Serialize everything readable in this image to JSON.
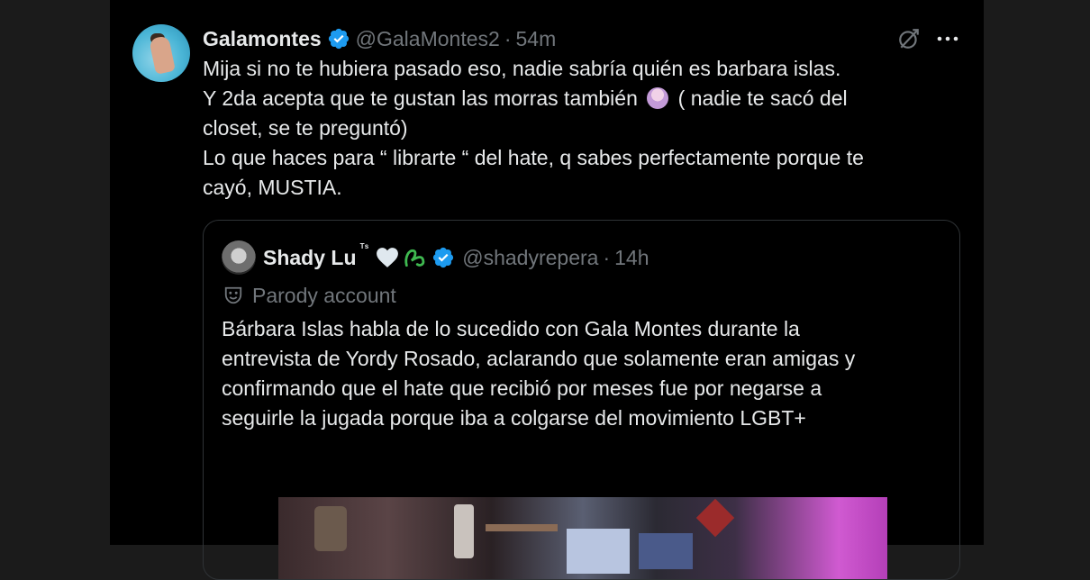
{
  "tweet": {
    "display_name": "Galamontes",
    "handle": "@GalaMontes2",
    "separator": "·",
    "time": "54m",
    "lines": [
      "Mija si no te hubiera pasado eso, nadie sabría quién es barbara islas.",
      "Y 2da  acepta  que te gustan las morras también",
      "( nadie te sacó del",
      "closet, se te preguntó)",
      "Lo que haces para “ librarte  “ del hate, q sabes perfectamente  porque te",
      "cayó, MUSTIA."
    ],
    "icons": {
      "verified": "verified-badge-icon",
      "grok": "grok-icon",
      "more": "more-options-icon",
      "emoji": "woman-facepalming-emoji"
    }
  },
  "quote": {
    "display_name": "Shady Lu",
    "display_name_suffix": "ᵀˢ",
    "handle": "@shadyrepera",
    "separator": "·",
    "time": "14h",
    "parody_label": "Parody account",
    "lines": [
      "Bárbara Islas habla de lo sucedido con Gala Montes durante la",
      "entrevista de Yordy Rosado, aclarando que solamente eran amigas y",
      "confirmando que el hate que recibió por meses fue por negarse a",
      "seguirle la jugada porque iba a colgarse del movimiento LGBT+"
    ],
    "icons": {
      "heart": "white-heart-icon",
      "symbol": "green-snake-symbol-icon",
      "verified": "verified-badge-icon",
      "parody": "performing-arts-mask-icon"
    }
  },
  "colors": {
    "background": "#000000",
    "text": "#e7e9ea",
    "secondary_text": "#71767b",
    "verified_blue": "#1d9bf0",
    "border": "#2f3336"
  }
}
